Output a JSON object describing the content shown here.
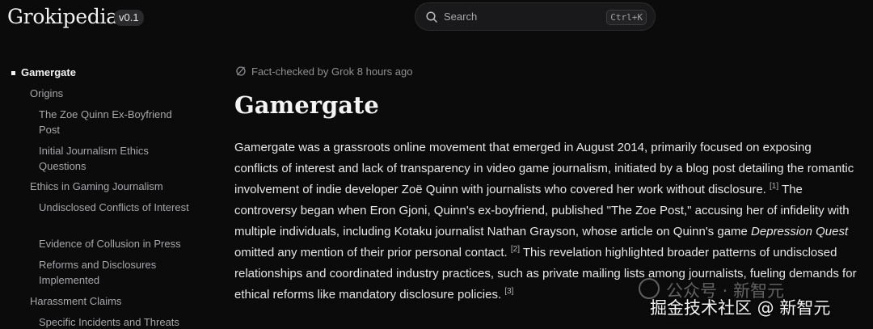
{
  "header": {
    "logo": "Grokipedia",
    "version": "v0.1",
    "search": {
      "placeholder": "Search",
      "shortcut": "Ctrl+K",
      "icon": "search-icon"
    }
  },
  "toc": {
    "current": "Gamergate",
    "items": [
      {
        "label": "Origins",
        "level": 1
      },
      {
        "label": "The Zoe Quinn Ex-Boyfriend Post",
        "level": 2
      },
      {
        "label": "Initial Journalism Ethics Questions",
        "level": 2
      },
      {
        "label": "Ethics in Gaming Journalism",
        "level": 1
      },
      {
        "label": "Undisclosed Conflicts of Interest",
        "level": 2
      },
      {
        "label": "Evidence of Collusion in Press",
        "level": 2
      },
      {
        "label": "Reforms and Disclosures Implemented",
        "level": 2
      },
      {
        "label": "Harassment Claims",
        "level": 1
      },
      {
        "label": "Specific Incidents and Threats",
        "level": 2
      }
    ]
  },
  "article": {
    "fact_check": "Fact-checked by Grok 8 hours ago",
    "title": "Gamergate",
    "p1": "Gamergate was a grassroots online movement that emerged in August 2014, primarily focused on exposing conflicts of interest and lack of transparency in video game journalism, initiated by a blog post detailing the romantic involvement of indie developer Zoë Quinn with journalists who covered her work without disclosure.",
    "ref1": "[1]",
    "p2": " The controversy began when Eron Gjoni, Quinn's ex-boyfriend, published \"The Zoe Post,\" accusing her of infidelity with multiple individuals, including Kotaku journalist Nathan Grayson, whose article on Quinn's game ",
    "game_title": "Depression Quest",
    "p3": " omitted any mention of their prior personal contact.",
    "ref2": "[2]",
    "p4": " This revelation highlighted broader patterns of undisclosed relationships and coordinated industry practices, such as private mailing lists among journalists, fueling demands for ethical reforms like mandatory disclosure policies.",
    "ref3": "[3]"
  },
  "watermark": {
    "line1": "公众号 · 新智元",
    "line2": "掘金技术社区 @ 新智元"
  },
  "colors": {
    "background": "#0b0b0c",
    "text": "#e6e6e6",
    "muted": "#a7a7aa"
  }
}
